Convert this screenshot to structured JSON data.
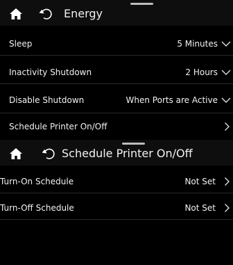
{
  "energy_screen": {
    "title": "Energy",
    "items": [
      {
        "label": "Sleep",
        "value": "5 Minutes",
        "chevron": "chevron-down-icon"
      },
      {
        "label": "Inactivity Shutdown",
        "value": "2 Hours",
        "chevron": "chevron-down-icon"
      },
      {
        "label": "Disable Shutdown",
        "value": "When Ports are Active",
        "chevron": "chevron-down-icon"
      },
      {
        "label": "Schedule Printer On/Off",
        "value": "",
        "chevron": "chevron-right-icon"
      }
    ]
  },
  "schedule_screen": {
    "title": "Schedule Printer On/Off",
    "items": [
      {
        "label": "Turn-On Schedule",
        "value": "Not Set",
        "chevron": "chevron-right-icon"
      },
      {
        "label": "Turn-Off Schedule",
        "value": "Not Set",
        "chevron": "chevron-right-icon"
      }
    ]
  },
  "icons": {
    "home": "home-icon",
    "back": "back-arrow-icon"
  },
  "colors": {
    "background": "#000000",
    "header": "#0e0e0e",
    "text": "#f2f2f2",
    "separator": "#2a2a2a"
  }
}
